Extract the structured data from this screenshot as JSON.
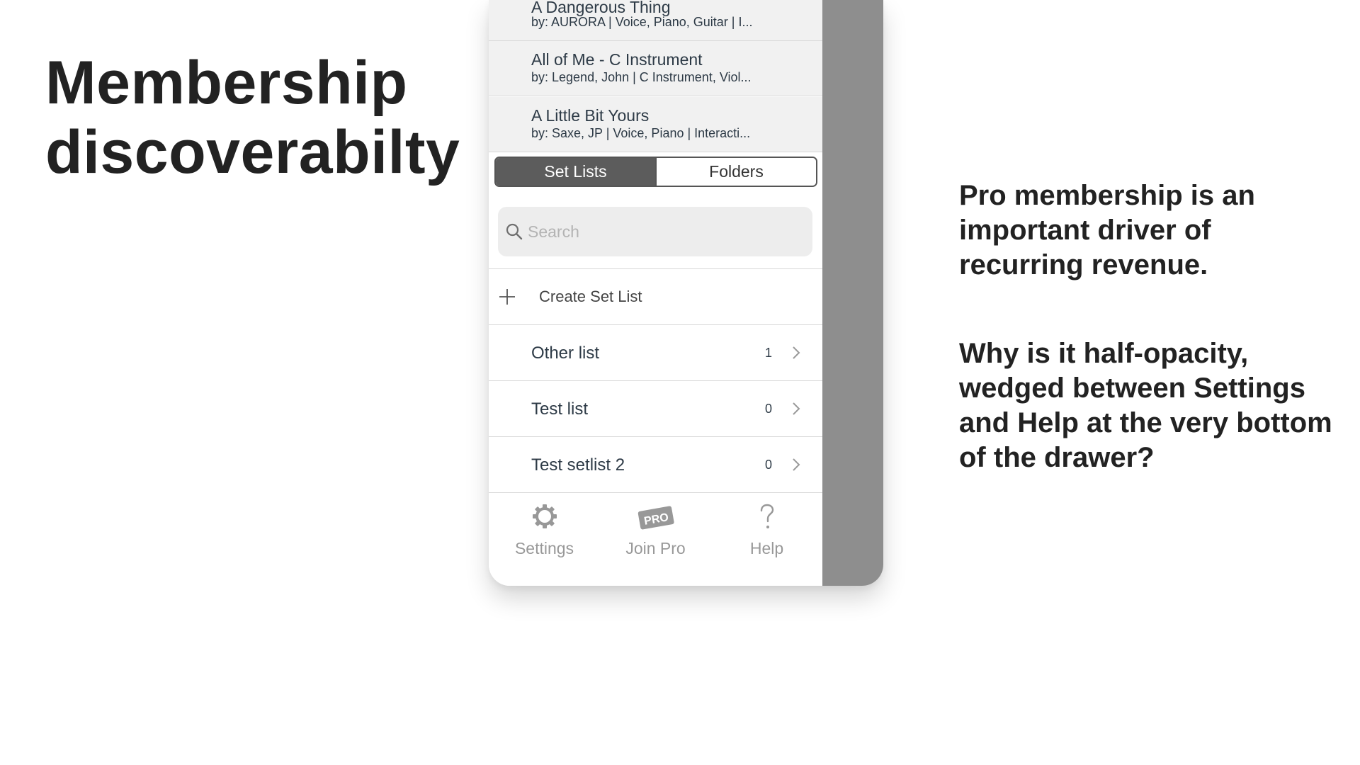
{
  "slide": {
    "title_line1": "Membership",
    "title_line2": "discoverabilty",
    "note1": "Pro membership is an important driver of recurring revenue.",
    "note2": "Why is it half-opacity, wedged between Settings and Help at the very bottom of the drawer?"
  },
  "songs": [
    {
      "title": "A Dangerous Thing",
      "subtitle": "by: AURORA | Voice, Piano, Guitar | I..."
    },
    {
      "title": "All of Me - C Instrument",
      "subtitle": "by: Legend, John | C Instrument, Viol..."
    },
    {
      "title": "A Little Bit Yours",
      "subtitle": "by: Saxe, JP | Voice, Piano | Interacti..."
    }
  ],
  "segmented": {
    "set_lists": "Set Lists",
    "folders": "Folders",
    "selected": "Set Lists"
  },
  "search": {
    "placeholder": "Search",
    "value": ""
  },
  "create": {
    "label": "Create Set List"
  },
  "set_lists": [
    {
      "name": "Other list",
      "count": "1"
    },
    {
      "name": "Test list",
      "count": "0"
    },
    {
      "name": "Test setlist 2",
      "count": "0"
    }
  ],
  "tabbar": {
    "settings": "Settings",
    "join_pro": "Join Pro",
    "pro_badge": "PRO",
    "help": "Help",
    "tab_opacity": 0.5
  },
  "colors": {
    "overlay": "#8e8e8e",
    "segment_active": "#5c5c5c",
    "row_background": "#f1f1f1",
    "text_primary": "#2d3a46"
  }
}
